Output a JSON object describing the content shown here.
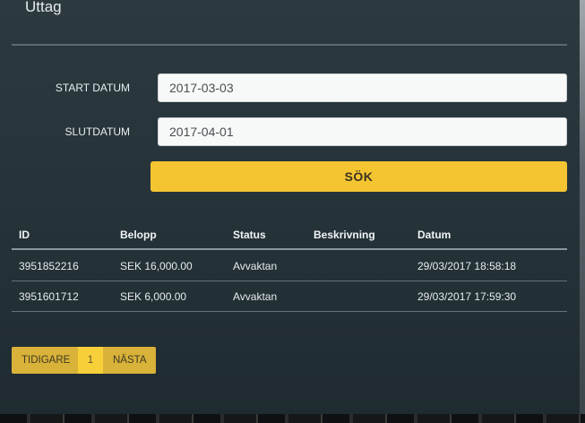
{
  "page": {
    "title": "Uttag"
  },
  "form": {
    "start_label": "START DATUM",
    "start_value": "2017-03-03",
    "end_label": "SLUTDATUM",
    "end_value": "2017-04-01",
    "search_label": "SÖK"
  },
  "table": {
    "columns": [
      "ID",
      "Belopp",
      "Status",
      "Beskrivning",
      "Datum"
    ],
    "rows": [
      [
        "3951852216",
        "SEK 16,000.00",
        "Avvaktan",
        "",
        "29/03/2017 18:58:18"
      ],
      [
        "3951601712",
        "SEK 6,000.00",
        "Avvaktan",
        "",
        "29/03/2017 17:59:30"
      ]
    ]
  },
  "pagination": {
    "prev_label": "TIDIGARE",
    "current_page": "1",
    "next_label": "NÄSTA"
  },
  "colors": {
    "accent": "#f4c531",
    "pager": "#d9b23a",
    "panel": "#2a383e"
  }
}
